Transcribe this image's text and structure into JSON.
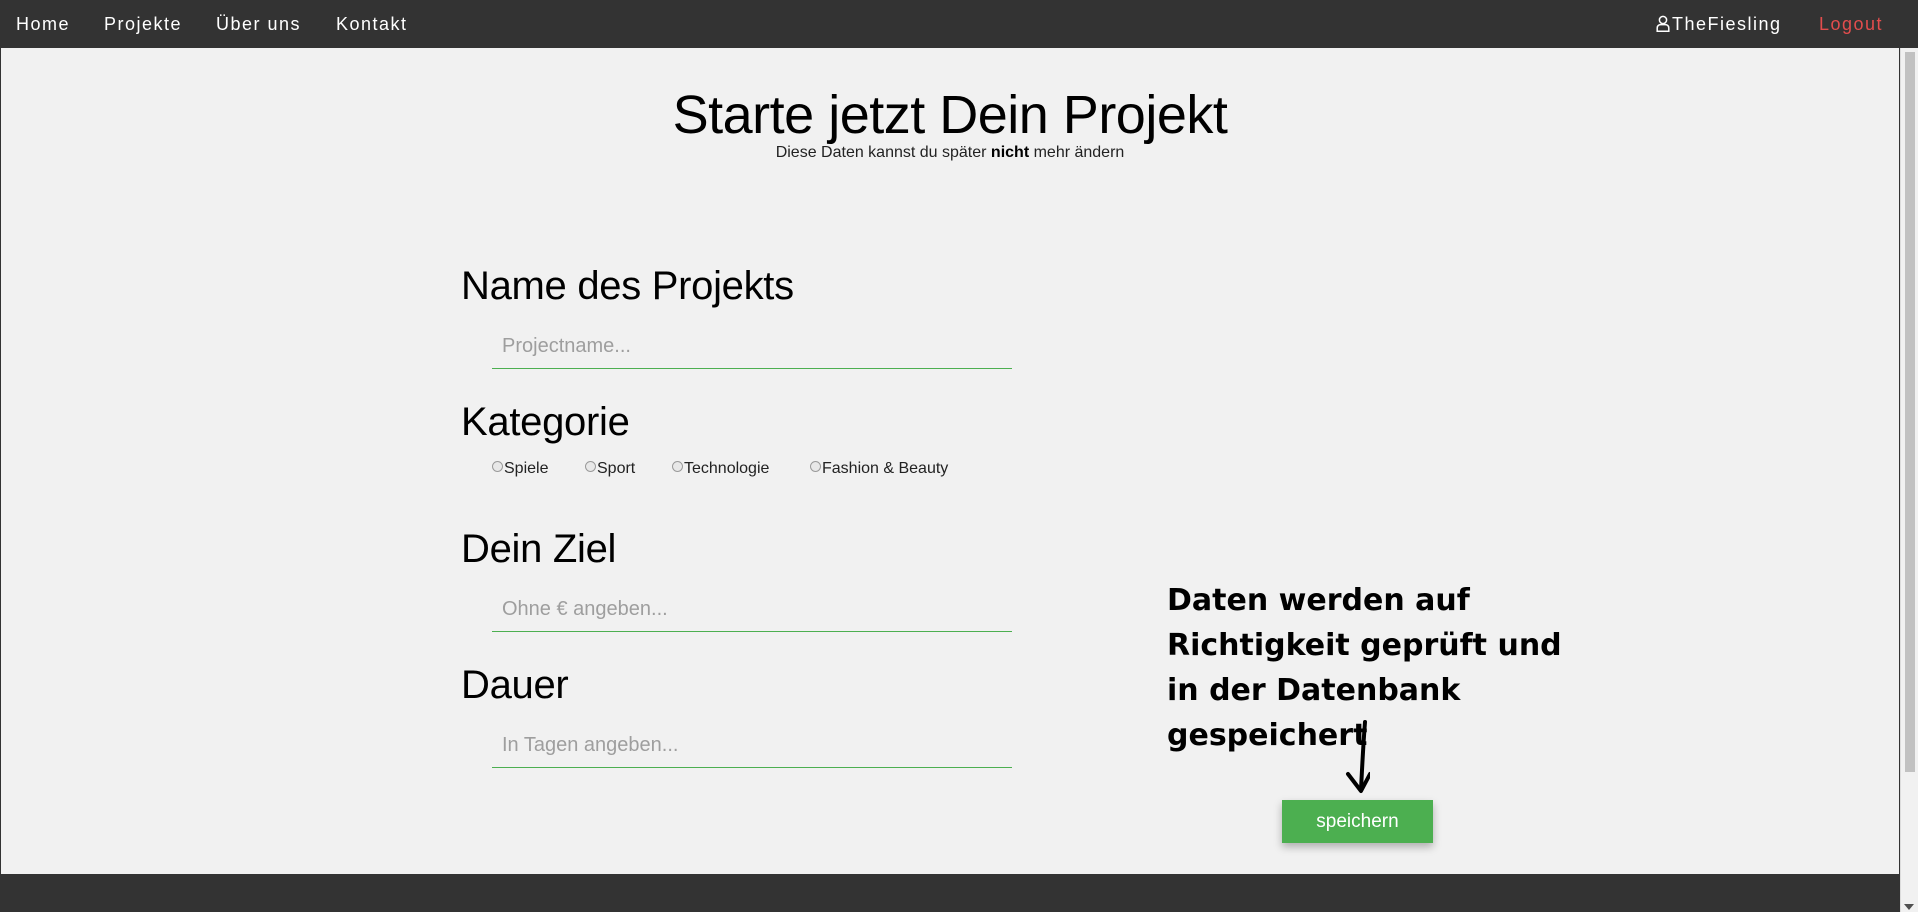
{
  "nav": {
    "items": [
      {
        "label": "Home"
      },
      {
        "label": "Projekte"
      },
      {
        "label": "Über uns"
      },
      {
        "label": "Kontakt"
      }
    ],
    "user": {
      "icon": "user-icon",
      "name": "TheFiesling"
    },
    "logout_label": "Logout",
    "logout_color": "#e34d4d"
  },
  "page": {
    "title": "Starte jetzt Dein Projekt",
    "subtitle_before": "Diese Daten kannst du später ",
    "subtitle_bold": "nicht",
    "subtitle_after": " mehr ändern"
  },
  "form": {
    "name": {
      "heading": "Name des Projekts",
      "placeholder": "Projectname...",
      "value": ""
    },
    "category": {
      "heading": "Kategorie",
      "options": [
        {
          "label": "Spiele",
          "checked": false
        },
        {
          "label": "Sport",
          "checked": false
        },
        {
          "label": "Technologie",
          "checked": false
        },
        {
          "label": "Fashion & Beauty",
          "checked": false
        }
      ]
    },
    "goal": {
      "heading": "Dein Ziel",
      "placeholder": "Ohne € angeben...",
      "value": ""
    },
    "duration": {
      "heading": "Dauer",
      "placeholder": "In Tagen angeben...",
      "value": ""
    },
    "save_label": "speichern"
  },
  "annotation": {
    "lines": [
      "Daten werden auf",
      "Richtigkeit geprüft und",
      "in der Datenbank",
      "gespeichert"
    ]
  },
  "colors": {
    "nav_bg": "#333333",
    "content_bg": "#f1f1f1",
    "accent_green": "#4caf50"
  }
}
